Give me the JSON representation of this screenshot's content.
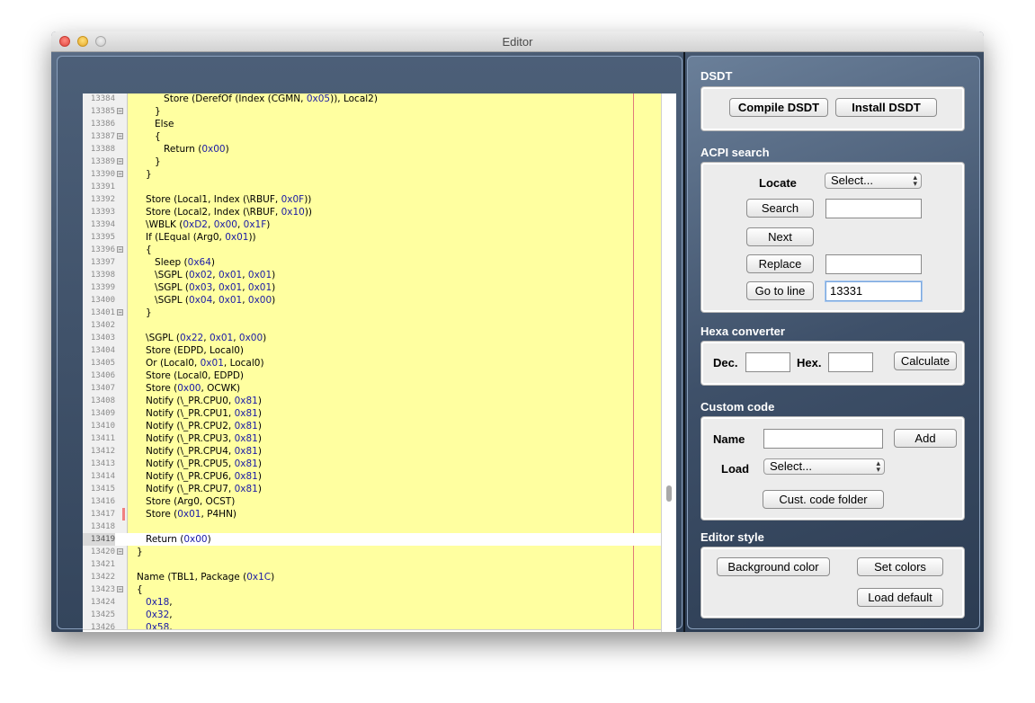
{
  "window": {
    "title": "Editor"
  },
  "editor": {
    "lines": [
      {
        "n": "13384",
        "fold": false,
        "code": "            Store (DerefOf (Index (CGMN, 0x05)), Local2)"
      },
      {
        "n": "13385",
        "fold": true,
        "code": "         }"
      },
      {
        "n": "13386",
        "fold": false,
        "code": "         Else"
      },
      {
        "n": "13387",
        "fold": true,
        "code": "         {"
      },
      {
        "n": "13388",
        "fold": false,
        "code": "            Return (0x00)"
      },
      {
        "n": "13389",
        "fold": true,
        "code": "         }"
      },
      {
        "n": "13390",
        "fold": true,
        "code": "      }"
      },
      {
        "n": "13391",
        "fold": false,
        "code": ""
      },
      {
        "n": "13392",
        "fold": false,
        "code": "      Store (Local1, Index (\\RBUF, 0x0F))"
      },
      {
        "n": "13393",
        "fold": false,
        "code": "      Store (Local2, Index (\\RBUF, 0x10))"
      },
      {
        "n": "13394",
        "fold": false,
        "code": "      \\WBLK (0xD2, 0x00, 0x1F)"
      },
      {
        "n": "13395",
        "fold": false,
        "code": "      If (LEqual (Arg0, 0x01))"
      },
      {
        "n": "13396",
        "fold": true,
        "code": "      {"
      },
      {
        "n": "13397",
        "fold": false,
        "code": "         Sleep (0x64)"
      },
      {
        "n": "13398",
        "fold": false,
        "code": "         \\SGPL (0x02, 0x01, 0x01)"
      },
      {
        "n": "13399",
        "fold": false,
        "code": "         \\SGPL (0x03, 0x01, 0x01)"
      },
      {
        "n": "13400",
        "fold": false,
        "code": "         \\SGPL (0x04, 0x01, 0x00)"
      },
      {
        "n": "13401",
        "fold": true,
        "code": "      }"
      },
      {
        "n": "13402",
        "fold": false,
        "code": ""
      },
      {
        "n": "13403",
        "fold": false,
        "code": "      \\SGPL (0x22, 0x01, 0x00)"
      },
      {
        "n": "13404",
        "fold": false,
        "code": "      Store (EDPD, Local0)"
      },
      {
        "n": "13405",
        "fold": false,
        "code": "      Or (Local0, 0x01, Local0)"
      },
      {
        "n": "13406",
        "fold": false,
        "code": "      Store (Local0, EDPD)"
      },
      {
        "n": "13407",
        "fold": false,
        "code": "      Store (0x00, OCWK)"
      },
      {
        "n": "13408",
        "fold": false,
        "code": "      Notify (\\_PR.CPU0, 0x81)"
      },
      {
        "n": "13409",
        "fold": false,
        "code": "      Notify (\\_PR.CPU1, 0x81)"
      },
      {
        "n": "13410",
        "fold": false,
        "code": "      Notify (\\_PR.CPU2, 0x81)"
      },
      {
        "n": "13411",
        "fold": false,
        "code": "      Notify (\\_PR.CPU3, 0x81)"
      },
      {
        "n": "13412",
        "fold": false,
        "code": "      Notify (\\_PR.CPU4, 0x81)"
      },
      {
        "n": "13413",
        "fold": false,
        "code": "      Notify (\\_PR.CPU5, 0x81)"
      },
      {
        "n": "13414",
        "fold": false,
        "code": "      Notify (\\_PR.CPU6, 0x81)"
      },
      {
        "n": "13415",
        "fold": false,
        "code": "      Notify (\\_PR.CPU7, 0x81)"
      },
      {
        "n": "13416",
        "fold": false,
        "code": "      Store (Arg0, OCST)"
      },
      {
        "n": "13417",
        "fold": false,
        "code": "      Store (0x01, P4HN)",
        "marker": true
      },
      {
        "n": "13418",
        "fold": false,
        "code": ""
      },
      {
        "n": "13419",
        "fold": false,
        "code": "      Return (0x00)",
        "current": true
      },
      {
        "n": "13420",
        "fold": true,
        "code": "   }"
      },
      {
        "n": "13421",
        "fold": false,
        "code": ""
      },
      {
        "n": "13422",
        "fold": false,
        "code": "   Name (TBL1, Package (0x1C)"
      },
      {
        "n": "13423",
        "fold": true,
        "code": "   {"
      },
      {
        "n": "13424",
        "fold": false,
        "code": "      0x18,"
      },
      {
        "n": "13425",
        "fold": false,
        "code": "      0x32,"
      },
      {
        "n": "13426",
        "fold": false,
        "code": "      0x58,"
      }
    ]
  },
  "dsdt": {
    "title": "DSDT",
    "compile_label": "Compile DSDT",
    "install_label": "Install DSDT"
  },
  "acpi": {
    "title": "ACPI search",
    "locate_label": "Locate",
    "locate_value": "Select...",
    "search_label": "Search",
    "search_value": "",
    "next_label": "Next",
    "replace_label": "Replace",
    "replace_value": "",
    "goto_label": "Go to line",
    "goto_value": "13331"
  },
  "hexa": {
    "title": "Hexa converter",
    "dec_label": "Dec.",
    "dec_value": "",
    "hex_label": "Hex.",
    "hex_value": "",
    "calc_label": "Calculate"
  },
  "custom": {
    "title": "Custom code",
    "name_label": "Name",
    "name_value": "",
    "add_label": "Add",
    "load_label": "Load",
    "load_value": "Select...",
    "folder_label": "Cust. code folder"
  },
  "style": {
    "title": "Editor style",
    "bg_label": "Background color",
    "set_label": "Set colors",
    "default_label": "Load default"
  }
}
